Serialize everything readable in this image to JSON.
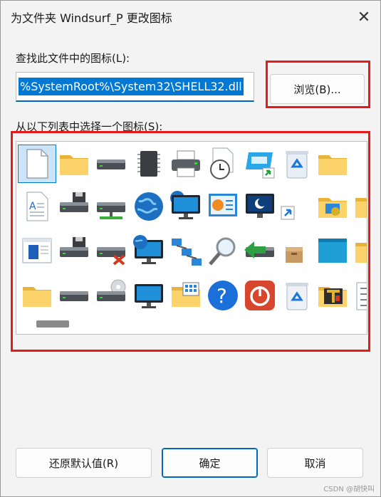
{
  "dialog": {
    "title": "为文件夹 Windsurf_P 更改图标",
    "close_glyph": "✕"
  },
  "search_label": "查找此文件中的图标(L):",
  "path_value": "%SystemRoot%\\System32\\SHELL32.dll",
  "browse_button": "浏览(B)...",
  "list_label": "从以下列表中选择一个图标(S):",
  "icons": [
    [
      "blank-document-icon",
      "folder-icon",
      "drive-icon",
      "chip-icon",
      "printer-icon",
      "clock-document-icon",
      "window-shortcut-icon",
      "recycle-bin-full-icon",
      "folder-icon"
    ],
    [
      "text-document-icon",
      "floppy-drive-icon",
      "network-drive-icon",
      "globe-icon",
      "network-globe-icon",
      "control-panel-icon",
      "sleep-monitor-icon",
      "shortcut-overlay-icon",
      "settings-folder-icon",
      "gear-folder-icon"
    ],
    [
      "app-window-icon",
      "floppy-drive-icon",
      "disconnected-drive-icon",
      "globe-monitor-icon",
      "network-icon",
      "search-icon",
      "eject-drive-icon",
      "box-icon",
      "blue-window-icon",
      "folder-icon"
    ],
    [
      "folder-icon",
      "drive-icon",
      "cd-drive-icon",
      "monitor-icon",
      "pictures-folder-icon",
      "help-icon",
      "power-icon",
      "recycle-bin-empty-icon",
      "tools-folder-icon",
      "list-icon"
    ]
  ],
  "buttons": {
    "restore_defaults": "还原默认值(R)",
    "ok": "确定",
    "cancel": "取消"
  },
  "watermark": "CSDN @胡快叫",
  "colors": {
    "accent": "#0067c0",
    "selection": "#0078d4",
    "highlight_box": "#e51a1a"
  }
}
